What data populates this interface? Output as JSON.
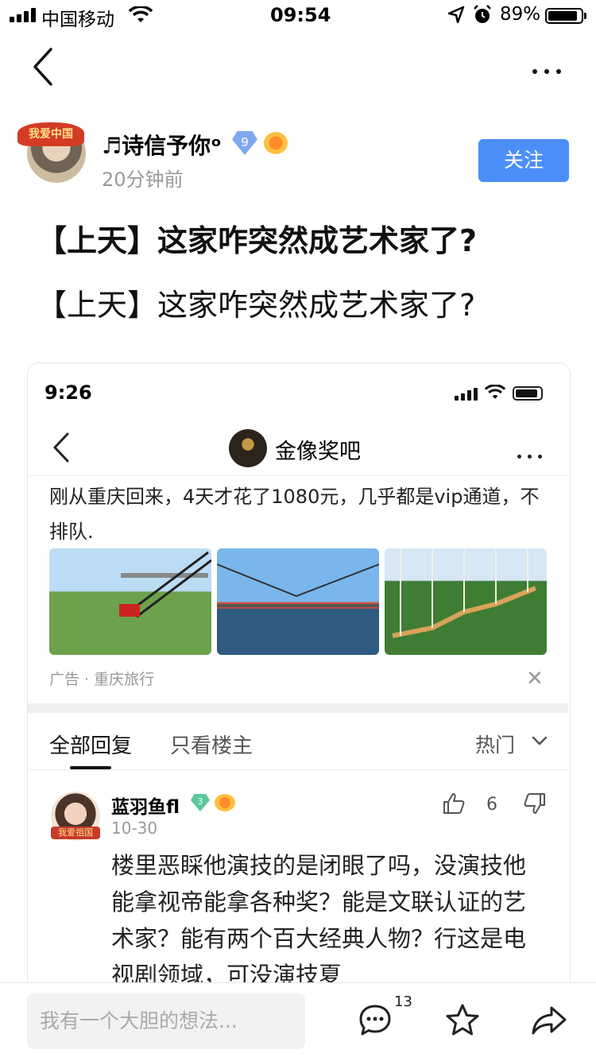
{
  "status_bar": {
    "carrier": "中国移动",
    "time": "09:54",
    "battery_pct": "89%",
    "battery_level": 0.89
  },
  "nav": {
    "back_icon": "chevron-left-icon",
    "more_icon": "more-dots-icon"
  },
  "author": {
    "name": "♬诗信予你ᵒ",
    "level": "9",
    "time": "20分钟前",
    "avatar_badge": "我爱中国",
    "follow_label": "关注"
  },
  "post": {
    "title": "【上天】这家咋突然成艺术家了?",
    "body": "【上天】这家咋突然成艺术家了?"
  },
  "screenshot": {
    "time": "9:26",
    "forum_name": "金像奖吧",
    "ad_text": "刚从重庆回来，4天才花了1080元，几乎都是vip通道，不排队.",
    "ad_source": "广告 · 重庆旅行",
    "ad_close": "✕",
    "tabs": {
      "all": "全部回复",
      "owner": "只看楼主",
      "sort": "热门"
    },
    "reply": {
      "name": "蓝羽鱼fl",
      "level": "3",
      "date": "10-30",
      "likes": "6",
      "avatar_badge": "我爱祖国",
      "text": "楼里恶睬他演技的是闭眼了吗，没演技他能拿视帝能拿各种奖？能是文联认证的艺术家？能有两个百大经典人物？行这是电视剧领域，可没演技夏"
    }
  },
  "bottom_bar": {
    "input_placeholder": "我有一个大胆的想法...",
    "comment_count": "13"
  },
  "colors": {
    "accent": "#4c8ef7",
    "badge_blue": "#7fa8f0",
    "badge_green": "#5cc79a"
  }
}
